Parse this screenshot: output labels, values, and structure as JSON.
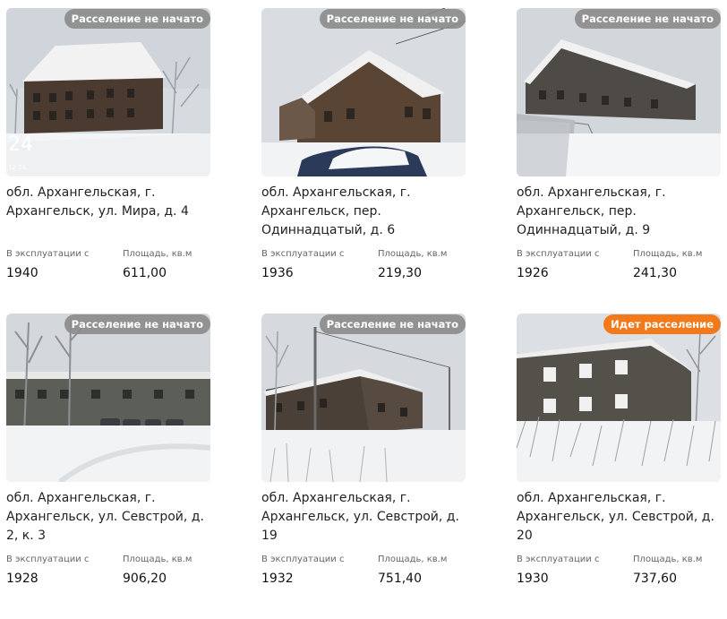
{
  "labels": {
    "year": "В эксплуатации с",
    "area": "Площадь, кв.м"
  },
  "cards": [
    {
      "badge": "Расселение не начато",
      "badge_status": "not-started",
      "address": "обл. Архангельская, г. Архангельск, ул. Мира, д. 4",
      "year": "1940",
      "area": "611,00",
      "photo_date_big": "24",
      "photo_date_small": "12:24"
    },
    {
      "badge": "Расселение не начато",
      "badge_status": "not-started",
      "address": "обл. Архангельская, г. Архангельск, пер. Одиннадцатый, д. 6",
      "year": "1936",
      "area": "219,30"
    },
    {
      "badge": "Расселение не начато",
      "badge_status": "not-started",
      "address": "обл. Архангельская, г. Архангельск, пер. Одиннадцатый, д. 9",
      "year": "1926",
      "area": "241,30"
    },
    {
      "badge": "Расселение не начато",
      "badge_status": "not-started",
      "address": "обл. Архангельская, г. Архангельск, ул. Севстрой, д. 2, к. 3",
      "year": "1928",
      "area": "906,20"
    },
    {
      "badge": "Расселение не начато",
      "badge_status": "not-started",
      "address": "обл. Архангельская, г. Архангельск, ул. Севстрой, д. 19",
      "year": "1932",
      "area": "751,40"
    },
    {
      "badge": "Идет расселение",
      "badge_status": "in-progress",
      "address": "обл. Архангельская, г. Архангельск, ул. Севстрой, д. 20",
      "year": "1930",
      "area": "737,60"
    }
  ],
  "colors": {
    "badge_grey": "#8c8c8c",
    "badge_orange": "#f27a1a"
  }
}
